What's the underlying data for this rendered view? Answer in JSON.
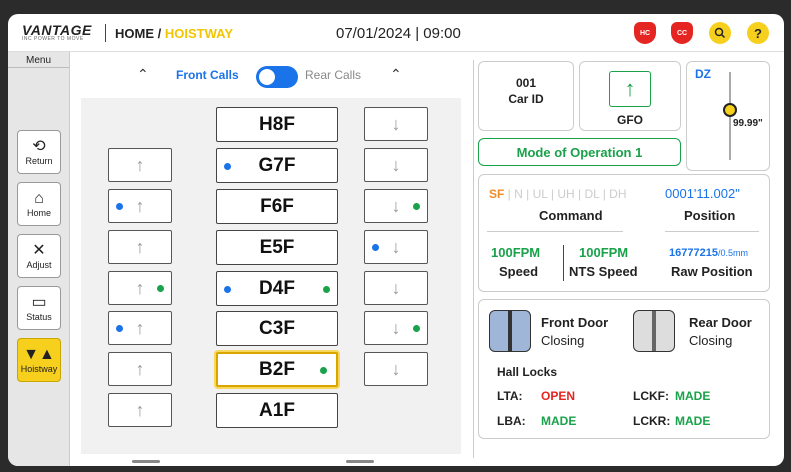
{
  "header": {
    "logo_text": "VANTAGE",
    "logo_subtext": "INC POWER TO MOVE",
    "breadcrumb_home": "HOME",
    "breadcrumb_sep": " / ",
    "breadcrumb_current": "HOISTWAY",
    "datetime": "07/01/2024 | 09:00",
    "badge_hc": "HC",
    "badge_cc": "CC",
    "help": "?"
  },
  "sidebar": {
    "menu_label": "Menu",
    "items": [
      {
        "label": "Return",
        "icon": "return-icon"
      },
      {
        "label": "Home",
        "icon": "home-icon"
      },
      {
        "label": "Adjust",
        "icon": "tools-icon"
      },
      {
        "label": "Status",
        "icon": "monitor-icon"
      },
      {
        "label": "Hoistway",
        "icon": "hoistway-icon",
        "active": true
      }
    ]
  },
  "calls": {
    "front_label": "Front Calls",
    "rear_label": "Rear Calls",
    "front_enabled": false
  },
  "floors": [
    "H8F",
    "G7F",
    "F6F",
    "E5F",
    "D4F",
    "C3F",
    "B2F",
    "A1F"
  ],
  "car": {
    "id_value": "001",
    "id_label": "Car ID",
    "direction_label": "GFO",
    "dz_label": "DZ",
    "dz_value": "99.99\"",
    "mode": "Mode of Operation 1"
  },
  "command": {
    "flags": [
      "SF",
      "N",
      "UL",
      "UH",
      "DL",
      "DH"
    ],
    "label": "Command",
    "position_value": "0001'11.002\"",
    "position_label": "Position",
    "speed_value": "100FPM",
    "speed_label": "Speed",
    "nts_value": "100FPM",
    "nts_label": "NTS Speed",
    "raw_value": "16777215",
    "raw_unit": "/0.5mm",
    "raw_label": "Raw Position"
  },
  "doors": {
    "front_label": "Front Door",
    "front_status": "Closing",
    "rear_label": "Rear Door",
    "rear_status": "Closing",
    "hall_locks_title": "Hall Locks",
    "locks": [
      {
        "name": "LTA:",
        "value": "OPEN"
      },
      {
        "name": "LCKF:",
        "value": "MADE"
      },
      {
        "name": "LBA:",
        "value": "MADE"
      },
      {
        "name": "LCKR:",
        "value": "MADE"
      }
    ]
  },
  "colors": {
    "accent_yellow": "#f7cf1d",
    "blue": "#1a73e8",
    "green": "#19a24a",
    "red": "#e52521"
  }
}
